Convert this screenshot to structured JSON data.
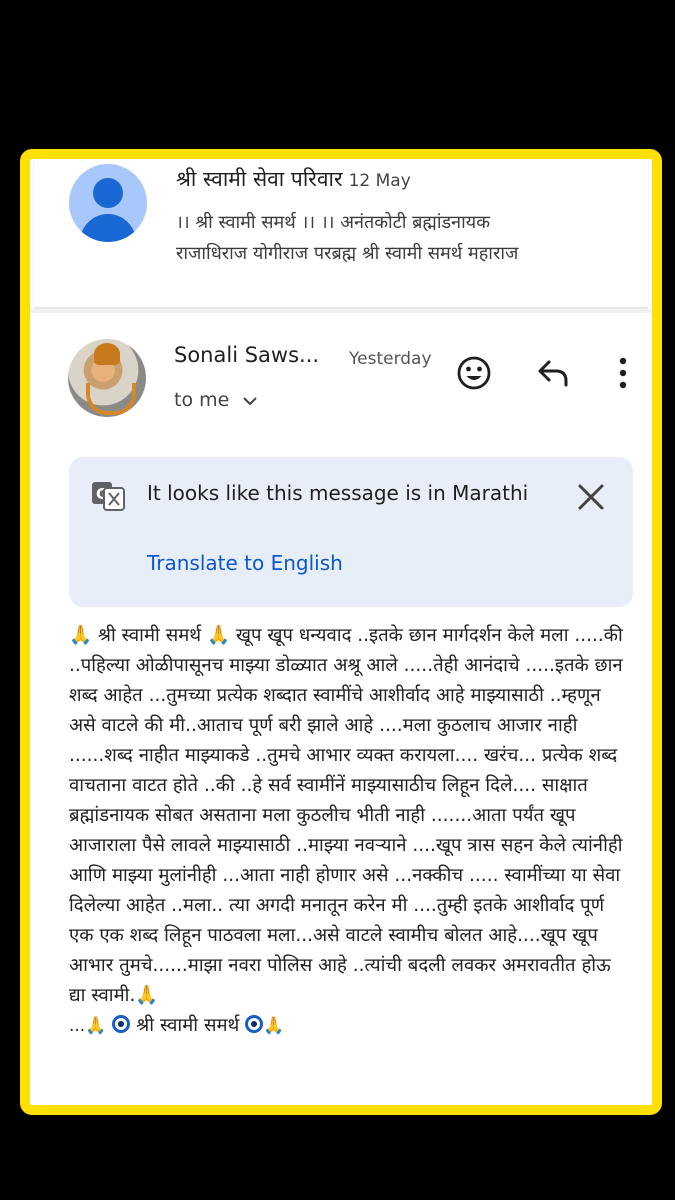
{
  "previous_email": {
    "sender": "श्री स्वामी सेवा परिवार",
    "date": "12 May",
    "snippet_line1": "।। श्री स्वामी समर्थ ।। ।। अनंतकोटी ब्रह्मांडनायक",
    "snippet_line2": "राजाधिराज योगीराज परब्रह्म श्री स्वामी समर्थ महाराज"
  },
  "message": {
    "sender": "Sonali Saws...",
    "time": "Yesterday",
    "recipient": "to me",
    "icons": [
      "add-reaction-icon",
      "reply-icon",
      "more-options-icon"
    ]
  },
  "translate_banner": {
    "text": "It looks like this message is in Marathi",
    "link": "Translate to English"
  },
  "body": {
    "text": "🙏 श्री स्वामी समर्थ 🙏 खूप खूप धन्यवाद ..इतके छान मार्गदर्शन केले मला .....की ..पहिल्या ओळीपासूनच माझ्या डोळ्यात अश्रू आले .....तेही आनंदाचे .....इतके छान शब्द आहेत ...तुमच्या प्रत्येक शब्दात स्वामींचे आशीर्वाद आहे माझ्यासाठी ..म्हणून असे वाटले की मी..आताच पूर्ण बरी झाले आहे ....मला कुठलाच आजार नाही ......शब्द नाहीत माझ्याकडे ..तुमचे आभार व्यक्त करायला.... खरंच... प्रत्येक शब्द वाचताना वाटत होते ..की ..हे सर्व स्वामींनें माझ्यासाठीच लिहून दिले.... साक्षात ब्रह्मांडनायक सोबत असताना मला कुठलीच भीती नाही .......आता पर्यंत खूप आजाराला पैसे लावले माझ्यासाठी ..माझ्या नवऱ्याने ....खूप त्रास सहन केले त्यांनीही आणि माझ्या मुलांनीही ...आता नाही होणार असे ...नक्कीच ..... स्वामींच्या या सेवा दिलेल्या आहेत ..मला.. त्या अगदी मनातून करेन मी ....तुम्ही इतके आशीर्वाद पूर्ण एक एक शब्द लिहून पाठवला मला...असे वाटले स्वामीच बोलत आहे....खूप खूप आभार तुमचे......माझा नवरा पोलिस आहे ..त्यांची बदली लवकर अमरावतीत होऊ द्या स्वामी.🙏",
    "closing_prefix": "...🙏",
    "closing_text": "श्री स्वामी समर्थ",
    "closing_suffix": "🙏"
  },
  "colors": {
    "frame_border": "#ffe000",
    "link": "#0b57d0",
    "banner_bg": "#e8eef7"
  }
}
